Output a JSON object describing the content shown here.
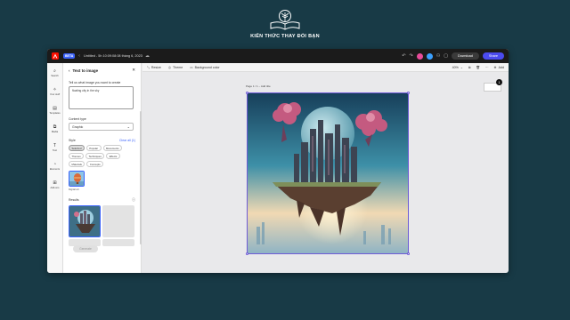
{
  "logo": {
    "text": "KIẾN THỨC THAY ĐỔI BẠN"
  },
  "topbar": {
    "beta": "BETA",
    "filename": "Untitled - 5h 10:09:08:08 tháng 6, 2023",
    "download_label": "Download",
    "share_label": "Share"
  },
  "rail": {
    "items": [
      {
        "icon": "search-icon",
        "label": "Search"
      },
      {
        "icon": "sparkle-icon",
        "label": "Your stuff"
      },
      {
        "icon": "template-icon",
        "label": "Templates"
      },
      {
        "icon": "media-icon",
        "label": "Media"
      },
      {
        "icon": "text-icon",
        "label": "Text"
      },
      {
        "icon": "elements-icon",
        "label": "Elements"
      },
      {
        "icon": "addons-icon",
        "label": "Add-ons"
      }
    ]
  },
  "panel": {
    "title": "Text to image",
    "prompt_label": "Tell us what image you want to create",
    "prompt_value": "floating city in the sky",
    "content_type_label": "Content type",
    "content_type_value": "Graphic",
    "style_label": "Style",
    "clear_label": "Clear all (1)",
    "style_chips": [
      "Selected",
      "Popular",
      "Movements",
      "Themes",
      "Techniques",
      "Effects",
      "Materials",
      "Concepts"
    ],
    "style_thumb_label": "Digital art",
    "results_label": "Results",
    "generate_label": "Generate"
  },
  "canvas": {
    "resize_label": "Resize",
    "theme_label": "Theme",
    "background_label": "Background color",
    "zoom": "40%",
    "add_label": "Add",
    "page_label": "Page 1 / 1 – Add title",
    "page_badge": "1"
  },
  "colors": {
    "accent": "#3b63fb",
    "share": "#4b4bf0",
    "bg": "#183a46"
  }
}
